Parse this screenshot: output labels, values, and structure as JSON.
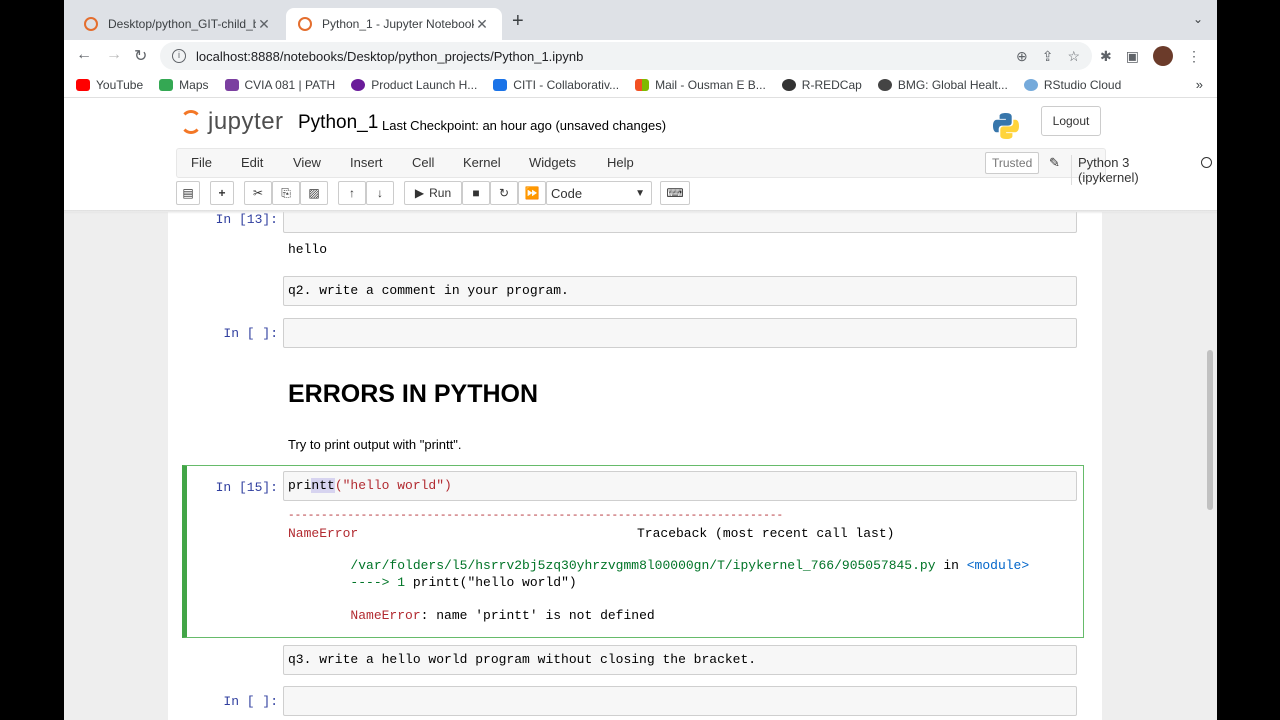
{
  "browser": {
    "tabs": [
      {
        "title": "Desktop/python_GIT-child_bra",
        "active": false
      },
      {
        "title": "Python_1 - Jupyter Notebook",
        "active": true
      }
    ],
    "url": "localhost:8888/notebooks/Desktop/python_projects/Python_1.ipynb",
    "bookmarks": [
      {
        "label": "YouTube",
        "color": "#ff0000"
      },
      {
        "label": "Maps",
        "color": "#34a853"
      },
      {
        "label": "CVIA 081 | PATH",
        "color": "#7b3fa0"
      },
      {
        "label": "Product Launch H...",
        "color": "#6a1b9a"
      },
      {
        "label": "CITI - Collaborativ...",
        "color": "#1a73e8"
      },
      {
        "label": "Mail - Ousman E B...",
        "color": "#f25022"
      },
      {
        "label": "R-REDCap",
        "color": "#333333"
      },
      {
        "label": "BMG: Global Healt...",
        "color": "#444444"
      },
      {
        "label": "RStudio Cloud",
        "color": "#75aadb"
      }
    ]
  },
  "jupyter": {
    "logo_text": "jupyter",
    "notebook_name": "Python_1",
    "checkpoint": "Last Checkpoint: an hour ago  (unsaved changes)",
    "logout": "Logout",
    "menu": [
      "File",
      "Edit",
      "View",
      "Insert",
      "Cell",
      "Kernel",
      "Widgets",
      "Help"
    ],
    "trusted": "Trusted",
    "kernel": "Python 3 (ipykernel)",
    "run_label": "Run",
    "cell_type": "Code"
  },
  "cells": {
    "c1_prompt": "In [13]:",
    "c1_output": "hello",
    "md_q2": "q2. write a comment in your program.",
    "c2_prompt": "In [ ]:",
    "heading": "ERRORS IN PYTHON",
    "instruction": "Try to print output with \"printt\".",
    "c3_prompt": "In [15]:",
    "c3_code_a": "pri",
    "c3_code_hl": "ntt",
    "c3_code_b": "(\"hello world\")",
    "tb_dashes": "---------------------------------------------------------------------------",
    "tb_err": "NameError",
    "tb_header": "Traceback (most recent call last)",
    "tb_path": "/var/folders/l5/hsrrv2bj5zq30yhrzvgmm8l00000gn/T/ipykernel_766/905057845.py",
    "tb_in": " in ",
    "tb_module": "<module>",
    "tb_arrow": "----> 1 ",
    "tb_line": "printt(\"hello world\")",
    "tb_final_name": "NameError",
    "tb_final_msg": ": name 'printt' is not defined",
    "md_q3": "q3. write a hello world program without closing the bracket.",
    "c4_prompt": "In [ ]:"
  }
}
